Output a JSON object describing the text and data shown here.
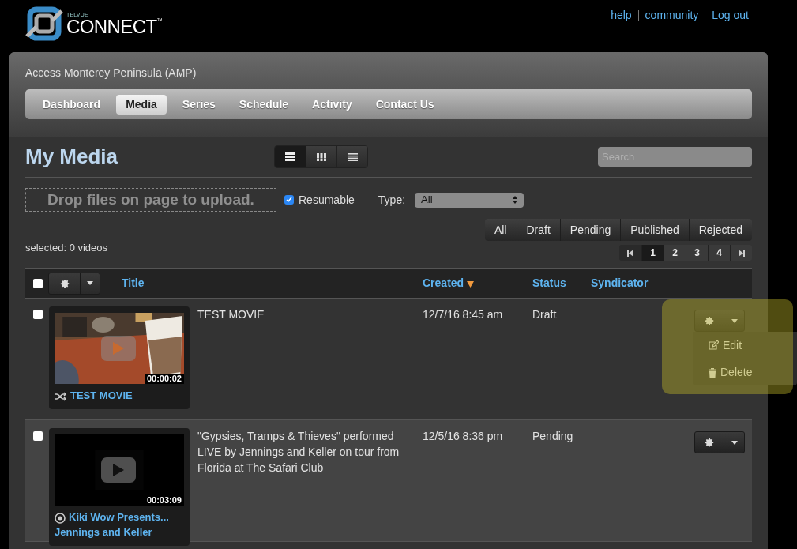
{
  "logo": {
    "brand": "TELVUE",
    "product": "CONNECT",
    "mark": "™"
  },
  "top_links": [
    "help",
    "community",
    "Log out"
  ],
  "organization": "Access Monterey Peninsula (AMP)",
  "nav": [
    {
      "label": "Dashboard",
      "selected": false
    },
    {
      "label": "Media",
      "selected": true
    },
    {
      "label": "Series",
      "selected": false
    },
    {
      "label": "Schedule",
      "selected": false
    },
    {
      "label": "Activity",
      "selected": false
    },
    {
      "label": "Contact Us",
      "selected": false
    }
  ],
  "heading": "My Media",
  "view_modes": [
    {
      "kind": "list",
      "selected": true
    },
    {
      "kind": "grid",
      "selected": false
    },
    {
      "kind": "lines",
      "selected": false
    }
  ],
  "search": {
    "placeholder": "Search"
  },
  "dropzone": "Drop files on page to upload.",
  "resumable": {
    "label": "Resumable",
    "checked": true
  },
  "type_filter": {
    "label": "Type:",
    "value": "All"
  },
  "status_filters": [
    "All",
    "Draft",
    "Pending",
    "Published",
    "Rejected"
  ],
  "selected_count": "selected: 0 videos",
  "pages": [
    {
      "label": "1",
      "selected": true
    },
    {
      "label": "2",
      "selected": false
    },
    {
      "label": "3",
      "selected": false
    },
    {
      "label": "4",
      "selected": false
    }
  ],
  "table": {
    "select_all": false,
    "columns": [
      "Title",
      "Created",
      "Status",
      "Syndicator"
    ],
    "rows": [
      {
        "checked": false,
        "duration": "00:00:02",
        "channel": {
          "kind": "shuffle",
          "label": "TEST MOVIE"
        },
        "title": "TEST MOVIE",
        "created": "12/7/16 8:45 am",
        "status": "Draft",
        "menu_open": true,
        "menu": [
          "Edit",
          "Delete"
        ]
      },
      {
        "checked": false,
        "duration": "00:03:09",
        "channel": {
          "kind": "target",
          "label": "Kiki Wow Presents... Jennings and Keller"
        },
        "title": "\"Gypsies, Tramps & Thieves\" performed LIVE by Jennings and Keller on tour from Florida at The Safari Club",
        "created": "12/5/16 8:36 pm",
        "status": "Pending",
        "menu_open": false,
        "menu": []
      }
    ]
  }
}
